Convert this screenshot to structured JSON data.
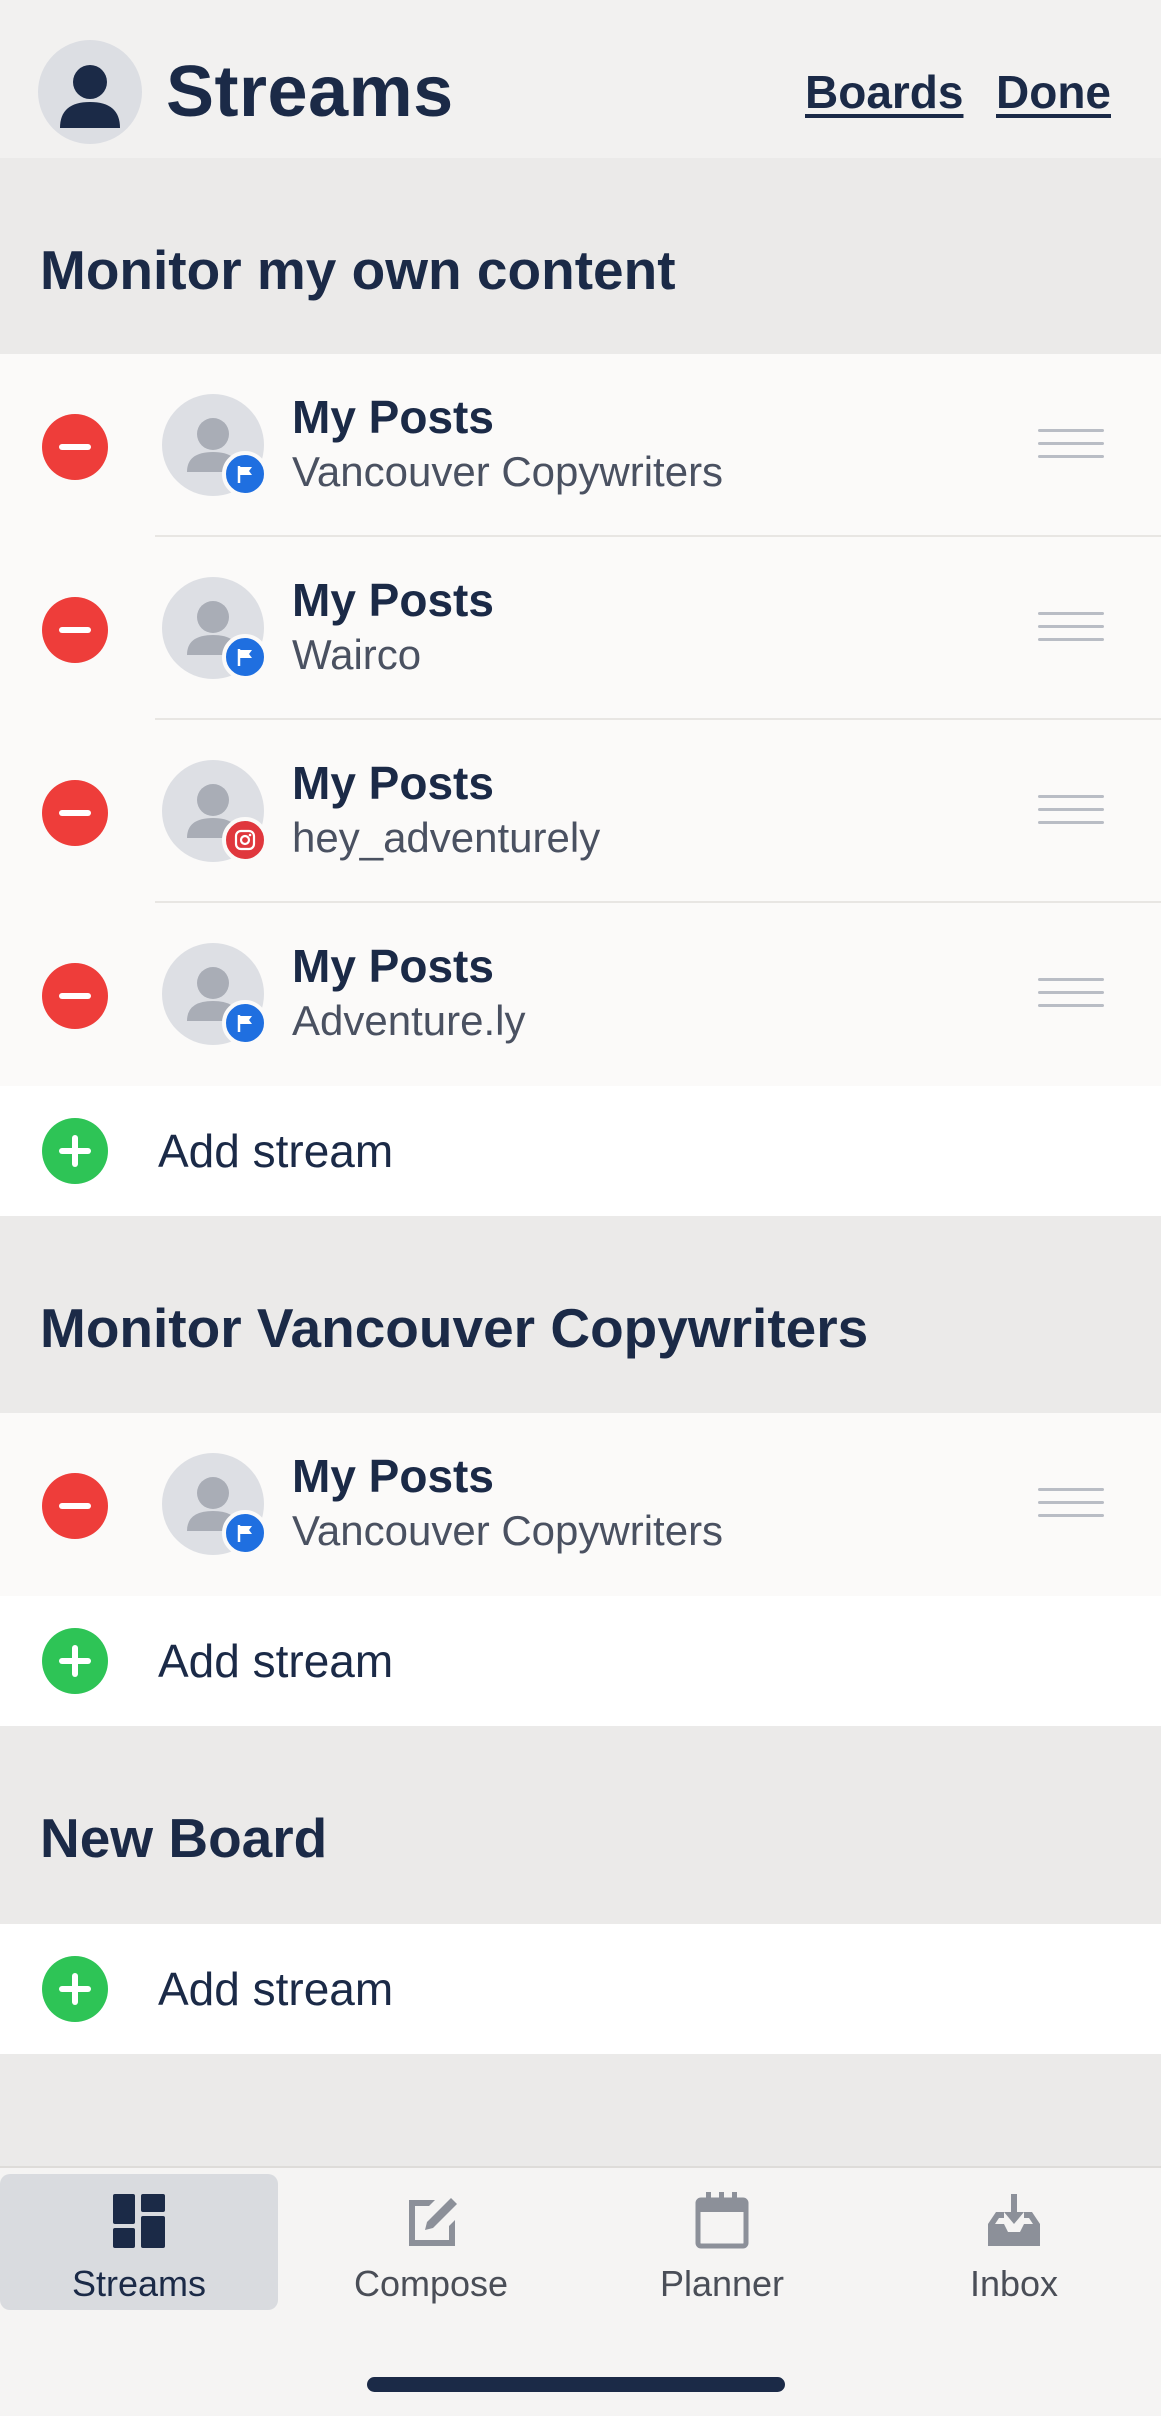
{
  "header": {
    "title": "Streams",
    "boards_label": "Boards",
    "done_label": "Done"
  },
  "sections": [
    {
      "title": "Monitor my own content",
      "streams": [
        {
          "title": "My Posts",
          "account": "Vancouver Copywriters",
          "network": "facebook"
        },
        {
          "title": "My Posts",
          "account": "Wairco",
          "network": "facebook"
        },
        {
          "title": "My Posts",
          "account": "hey_adventurely",
          "network": "instagram"
        },
        {
          "title": "My Posts",
          "account": "Adventure.ly",
          "network": "facebook"
        }
      ],
      "add_label": "Add stream"
    },
    {
      "title": "Monitor Vancouver Copywriters",
      "streams": [
        {
          "title": "My Posts",
          "account": "Vancouver Copywriters",
          "network": "facebook"
        }
      ],
      "add_label": "Add stream"
    },
    {
      "title": "New Board",
      "streams": [],
      "add_label": "Add stream"
    }
  ],
  "nav": {
    "items": [
      {
        "label": "Streams",
        "icon": "streams-icon",
        "active": true
      },
      {
        "label": "Compose",
        "icon": "compose-icon",
        "active": false
      },
      {
        "label": "Planner",
        "icon": "planner-icon",
        "active": false
      },
      {
        "label": "Inbox",
        "icon": "inbox-icon",
        "active": false
      }
    ]
  },
  "colors": {
    "remove": "#ee3d3a",
    "add": "#2ec456",
    "facebook_badge": "#1f6fe0",
    "instagram_badge": "#e0373d",
    "text_primary": "#1b2a47"
  }
}
